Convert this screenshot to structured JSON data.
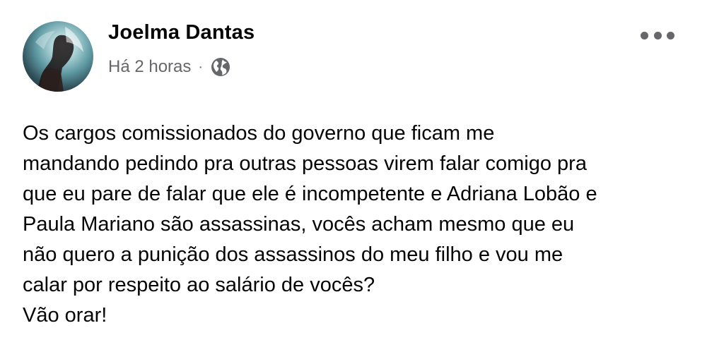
{
  "post": {
    "author": {
      "name": "Joelma Dantas",
      "avatar_icon": "profile-photo"
    },
    "timestamp": "Há 2 horas",
    "separator": "·",
    "privacy_icon": "globe-icon",
    "more_icon": "more-options-icon",
    "text_lines": [
      "Os cargos comissionados do governo que ficam me",
      "mandando pedindo pra outras pessoas virem falar comigo pra",
      "que eu pare de falar que ele é incompetente e Adriana Lobão e",
      "Paula Mariano são assassinas, vocês acham mesmo que eu",
      "não quero a punição dos assassinos do meu filho e vou me",
      "calar por respeito ao salário de vocês?",
      "Vão orar!"
    ]
  },
  "colors": {
    "name": "#050505",
    "meta": "#65676b",
    "text": "#050505",
    "background": "#ffffff"
  }
}
